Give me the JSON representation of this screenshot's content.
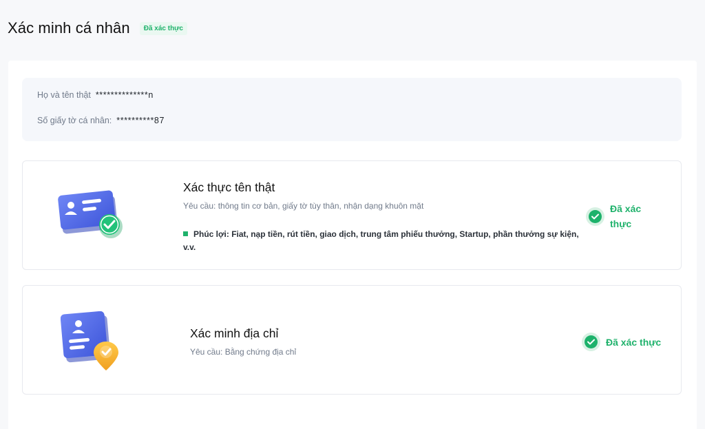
{
  "header": {
    "title": "Xác minh cá nhân",
    "badge": "Đã xác thực"
  },
  "info": {
    "name_label": "Họ và tên thật",
    "name_value": "**************n",
    "id_label": "Số giấy tờ cá nhân:",
    "id_value": "**********87"
  },
  "cards": [
    {
      "title": "Xác thực tên thật",
      "requirement": "Yêu cầu: thông tin cơ bản, giấy tờ tùy thân, nhận dạng khuôn mặt",
      "benefits": "Phúc lợi: Fiat, nạp tiền, rút tiền, giao dịch, trung tâm phiếu thưởng, Startup, phần thưởng sự kiện, v.v.",
      "status": "Đã xác thực",
      "icon": "id-card-check-icon"
    },
    {
      "title": "Xác minh địa chỉ",
      "requirement": "Yêu cầu: Bằng chứng địa chỉ",
      "status": "Đã xác thực",
      "icon": "address-card-pin-icon"
    }
  ],
  "colors": {
    "accent_green": "#20b26c",
    "card_blue": "#4f66e6",
    "pin_orange": "#f7b631"
  }
}
